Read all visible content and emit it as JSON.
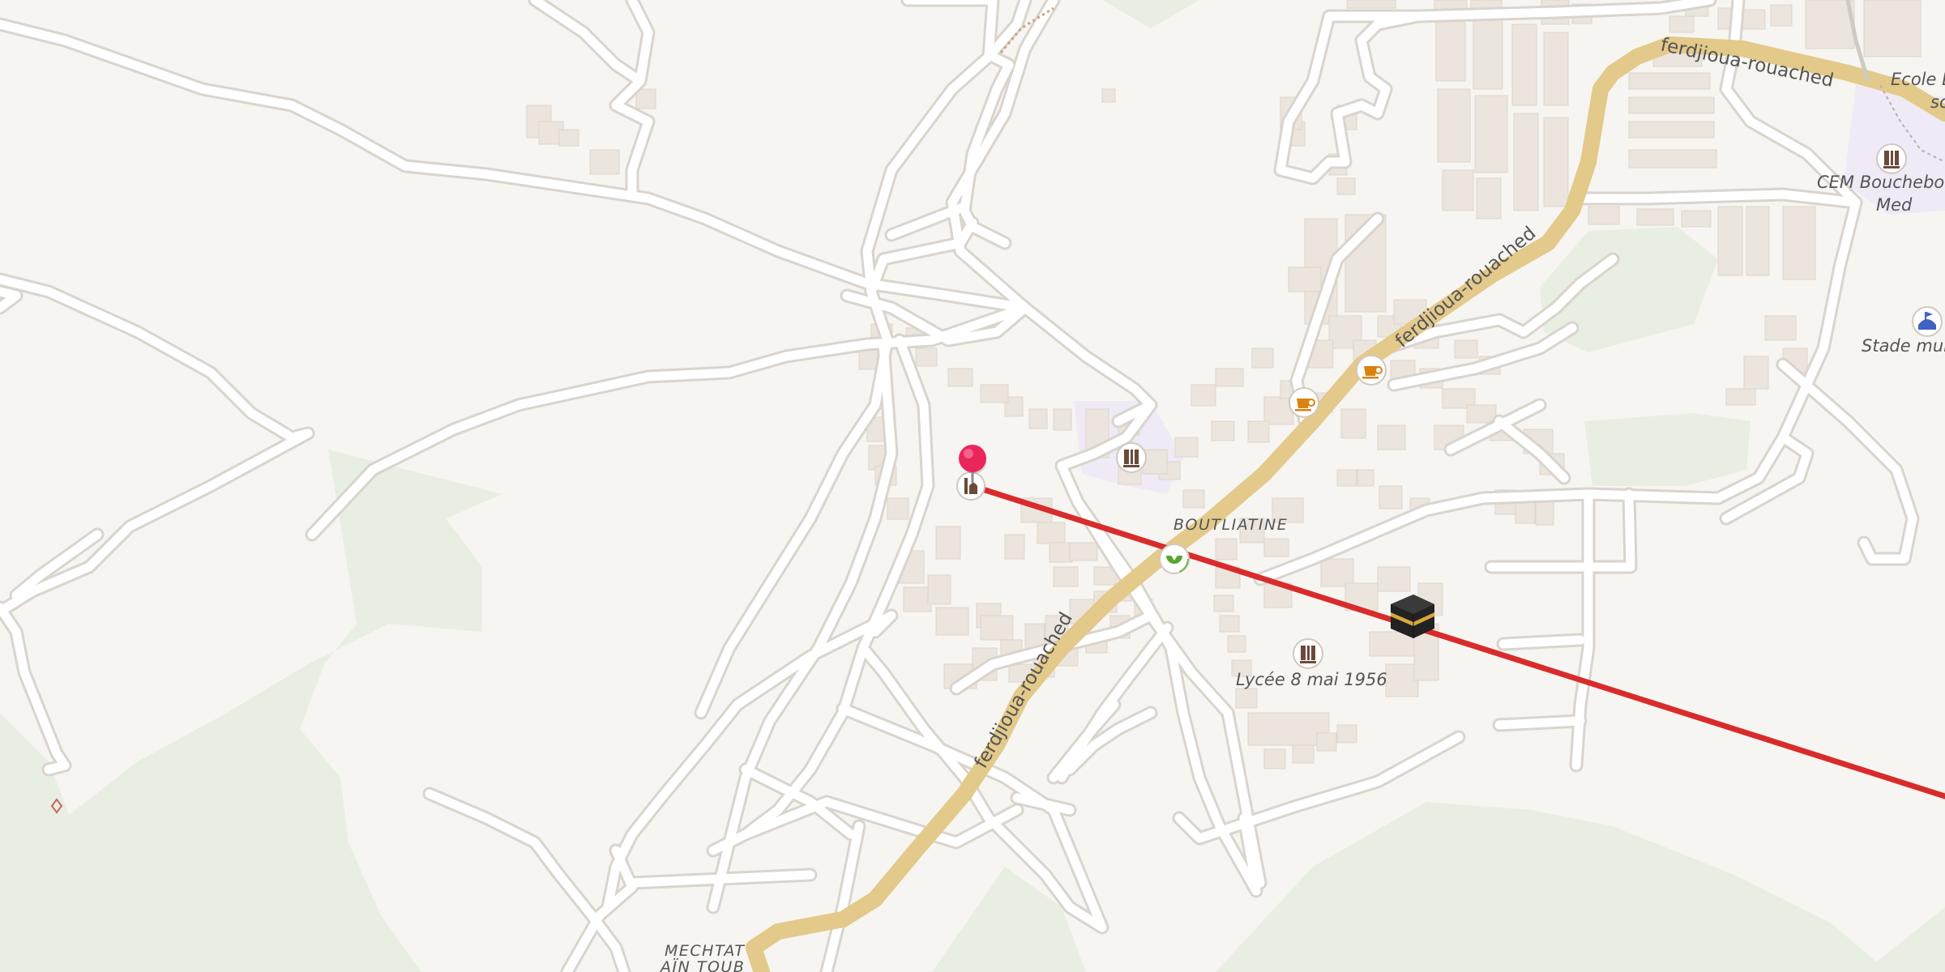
{
  "map": {
    "labels": {
      "road_upper": "ferdjioua-rouached",
      "road_mid": "ferdjioua-rouached",
      "road_lower": "ferdjioua-rouached",
      "place_center": "BOUTLIATINE",
      "place_south_line1": "MECHTAT",
      "place_south_line2": "AÏN TOUB",
      "school_lycee": "Lycée 8 mai 1956",
      "school_cem_line1": "CEM Bouchebou",
      "school_cem_line2": "Med",
      "school_ecole_line1": "Ecole B",
      "school_ecole_line2": "sc",
      "stadium": "Stade mun"
    },
    "icons": {
      "school": "school-icon",
      "cafe": "coffee-cup-icon",
      "shop": "shop-icon",
      "mosque": "mosque-icon",
      "kaaba": "kaaba-qibla-icon",
      "pin": "location-pin-icon",
      "stadium": "stadium-icon"
    },
    "colors": {
      "background": "#f7f5f1",
      "park": "#e8ede0",
      "main_road": "#fbe3a6",
      "main_road_casing": "#e8cd87",
      "minor_road": "#ffffff",
      "minor_road_casing": "#dedad4",
      "building": "#ece6df",
      "school_area": "#eee9f5",
      "qibla_line": "#d92b2b",
      "pin": "#e9265b"
    }
  }
}
